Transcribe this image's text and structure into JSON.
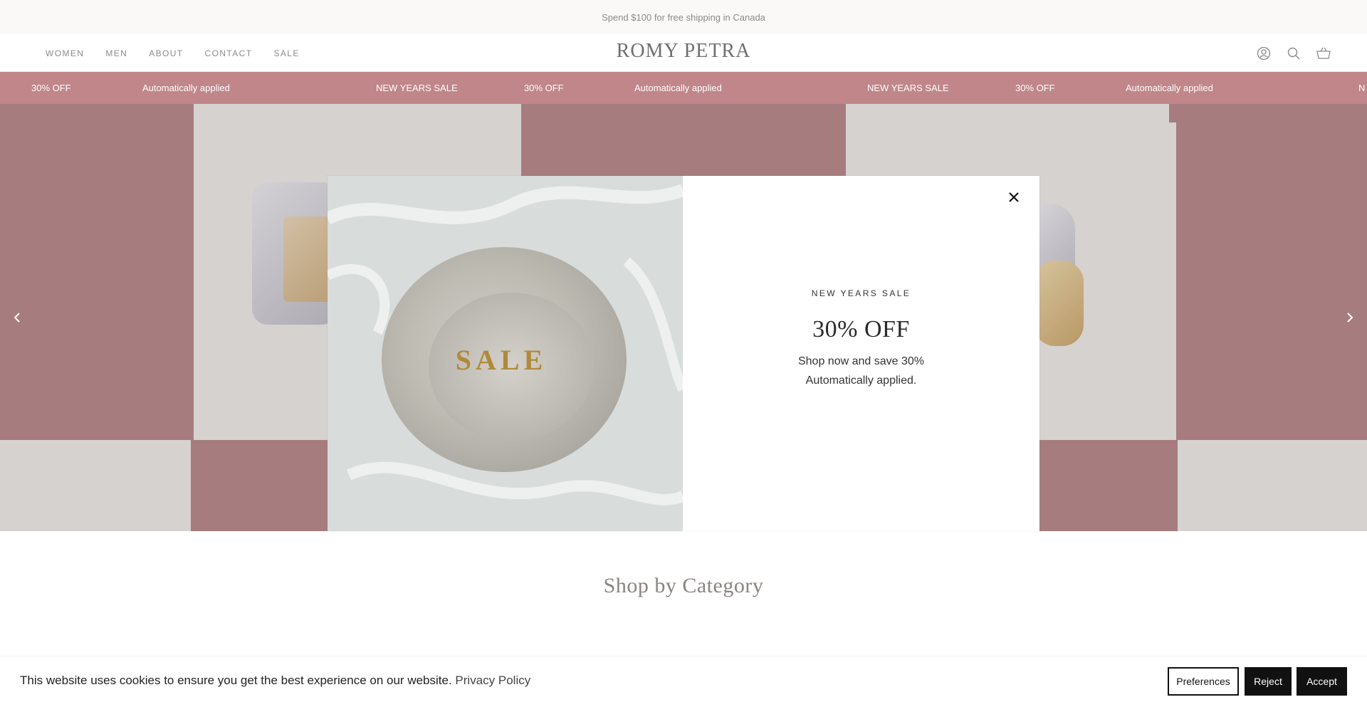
{
  "announcement": "Spend $100 for free shipping in Canada",
  "header": {
    "logo": "ROMY PETRA",
    "nav": [
      "WOMEN",
      "MEN",
      "ABOUT",
      "CONTACT",
      "SALE"
    ],
    "icons": [
      "account-icon",
      "search-icon",
      "cart-icon"
    ]
  },
  "ticker": {
    "items": [
      "30% OFF",
      "Automatically applied",
      "NEW YEARS SALE",
      "30% OFF",
      "Automatically applied",
      "NEW YEARS SALE",
      "30% OFF",
      "Automatically applied",
      "N"
    ]
  },
  "hero": {
    "prev_icon": "chevron-left-icon",
    "next_icon": "chevron-right-icon"
  },
  "popup": {
    "image_text": "SALE",
    "eyebrow": "NEW YEARS SALE",
    "headline": "30% OFF",
    "line1": "Shop now and save 30%",
    "line2": "Automatically applied.",
    "close_icon": "close-icon"
  },
  "section": {
    "title": "Shop by Category"
  },
  "cookie": {
    "text": "This website uses cookies to ensure you get the best experience on our website.",
    "link": "Privacy Policy",
    "preferences": "Preferences",
    "reject": "Reject",
    "accept": "Accept"
  },
  "colors": {
    "ticker_bg": "#c0868a",
    "tile_rose": "#b07f83",
    "tile_cream": "#ebe8e4",
    "button_dark": "#111111"
  }
}
